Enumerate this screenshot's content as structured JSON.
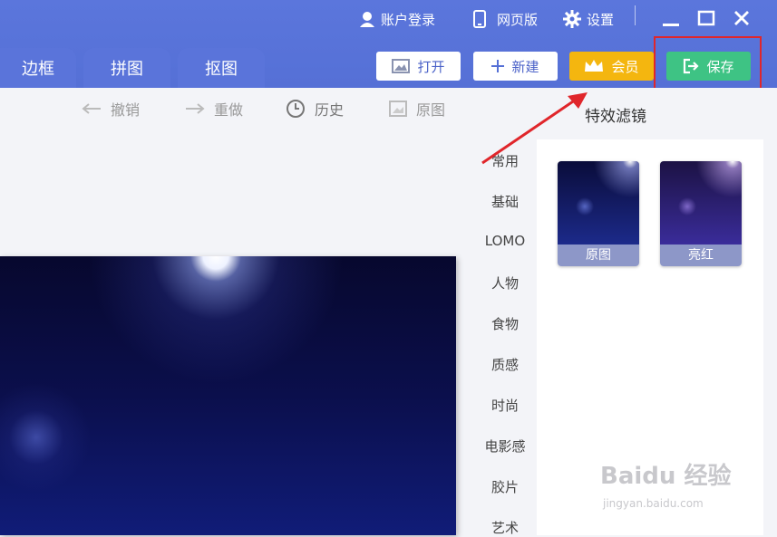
{
  "account": {
    "login_label": "账户登录",
    "web_label": "网页版",
    "settings_label": "设置"
  },
  "tabs": [
    {
      "label": "边框"
    },
    {
      "label": "拼图"
    },
    {
      "label": "抠图"
    }
  ],
  "actions": {
    "open_label": "打开",
    "new_label": "新建",
    "vip_label": "会员",
    "save_label": "保存"
  },
  "toolbar": {
    "undo_label": "撤销",
    "redo_label": "重做",
    "history_label": "历史",
    "original_label": "原图"
  },
  "panel": {
    "title": "特效滤镜",
    "categories": [
      "常用",
      "基础",
      "LOMO",
      "人物",
      "食物",
      "质感",
      "时尚",
      "电影感",
      "胶片",
      "艺术"
    ],
    "filters": [
      {
        "label": "原图"
      },
      {
        "label": "亮红"
      }
    ]
  },
  "watermark": {
    "brand": "Baidu 经验",
    "url": "jingyan.baidu.com"
  },
  "colors": {
    "topbar": "#5570d6",
    "save_green": "#3ec384",
    "vip_gold": "#f4b60f",
    "highlight_red": "#e0262b"
  }
}
